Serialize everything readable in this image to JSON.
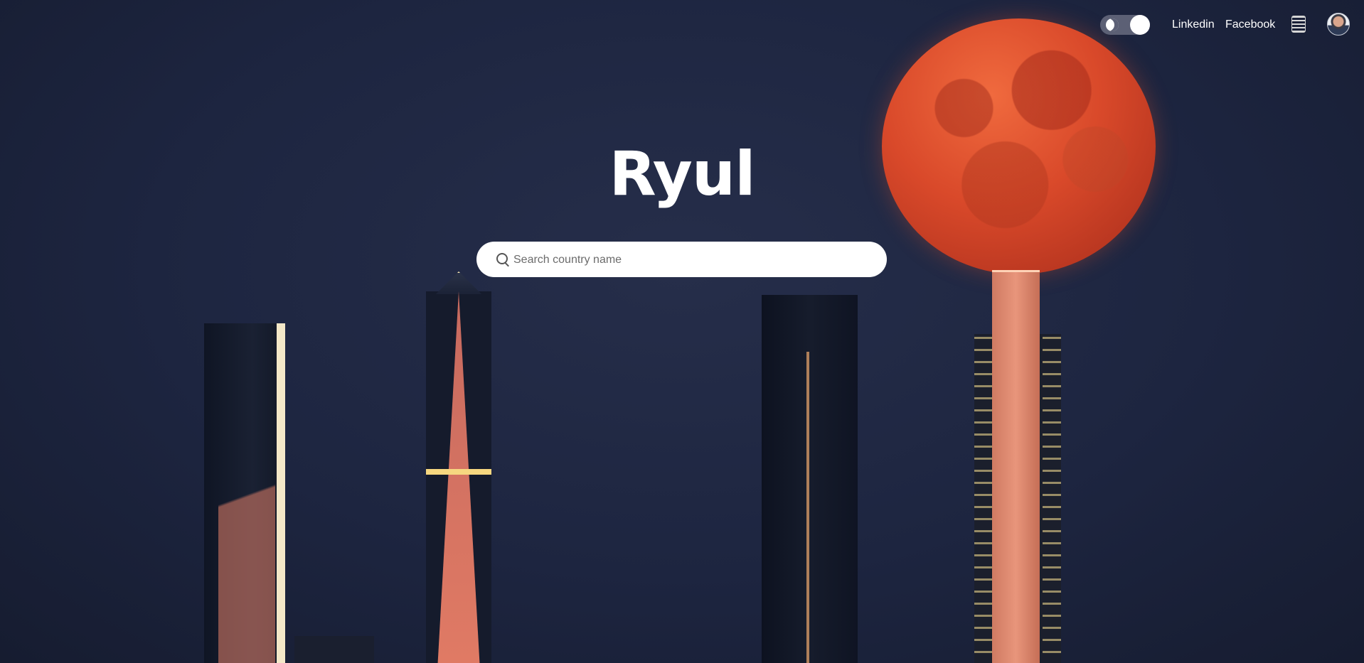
{
  "background": {
    "description_colors": {
      "sky": "#1f2640",
      "moon": "#d9492a"
    }
  },
  "header": {
    "theme_toggle": {
      "icon": "moon-icon",
      "state": "on"
    },
    "links": [
      {
        "label": "Linkedin"
      },
      {
        "label": "Facebook"
      }
    ],
    "apps_icon": "qr-code-icon",
    "avatar_icon": "user-avatar"
  },
  "main": {
    "title": "Ryul",
    "search": {
      "placeholder": "Search country name",
      "value": ""
    }
  }
}
